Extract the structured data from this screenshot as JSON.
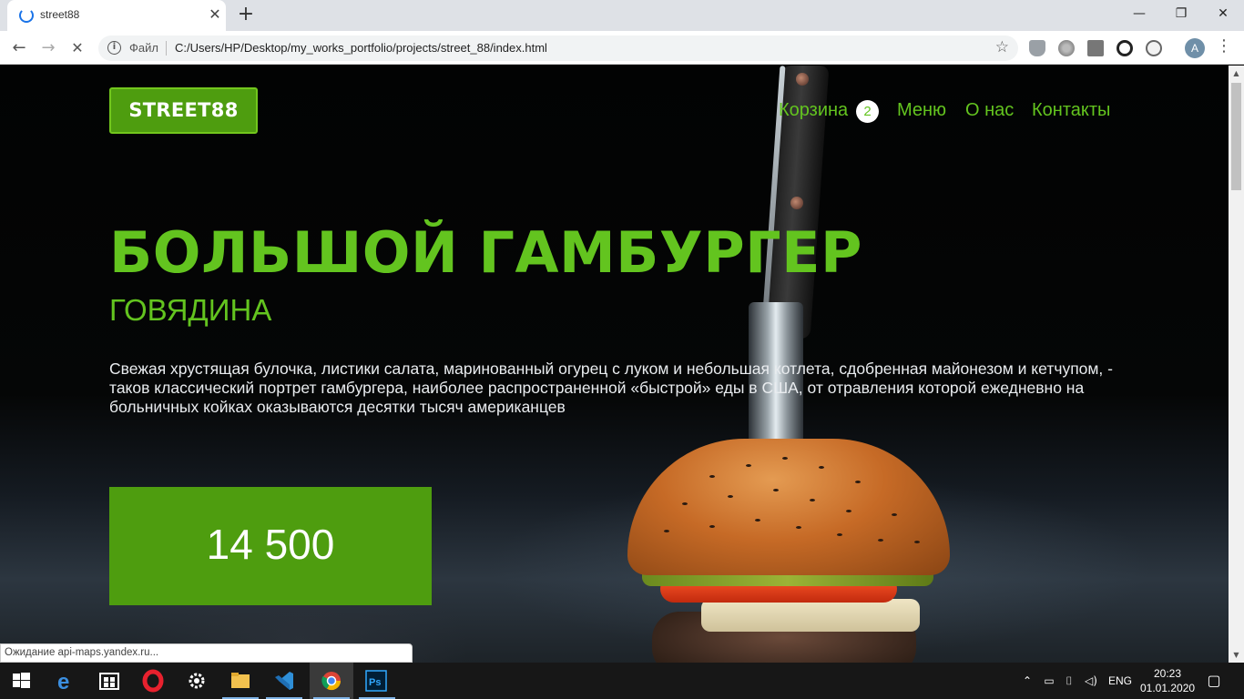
{
  "browser": {
    "tab": {
      "title": "street88",
      "close_glyph": "✕"
    },
    "new_tab_glyph": "+",
    "window_buttons": {
      "minimize": "—",
      "restore": "❐",
      "close": "✕"
    },
    "nav": {
      "back": "←",
      "forward": "→",
      "reload": "✕"
    },
    "omnibox": {
      "file_label": "Файл",
      "url": "C:/Users/HP/Desktop/my_works_portfolio/projects/street_88/index.html"
    },
    "profile_initial": "A",
    "menu_glyph": "⋮",
    "status_text": "Ожидание api-maps.yandex.ru..."
  },
  "site": {
    "logo": "STREET88",
    "nav": {
      "cart_label": "Корзина",
      "cart_count": "2",
      "menu_label": "Меню",
      "about_label": "О нас",
      "contacts_label": "Контакты"
    },
    "hero": {
      "title": "БОЛЬШОЙ ГАМБУРГЕР",
      "subtitle": "ГОВЯДИНА",
      "description": "Свежая хрустящая булочка, листики салата, маринованный огурец с луком и небольшая котлета, сдобренная майонезом и кетчупом, - таков классический портрет гамбургера, наиболее распространенной «быстрой» еды в США, от отравления которой ежедневно на больничных койках оказываются десятки тысяч американцев",
      "price": "14 500"
    },
    "colors": {
      "accent": "#63c41f",
      "button": "#4e9d0f",
      "logo_border": "#72c71d"
    }
  },
  "taskbar": {
    "apps": [
      "windows-start",
      "edge",
      "store",
      "opera",
      "settings",
      "file-explorer",
      "vscode",
      "chrome",
      "photoshop"
    ],
    "tray": {
      "language": "ENG",
      "time": "20:23",
      "date": "01.01.2020"
    }
  }
}
